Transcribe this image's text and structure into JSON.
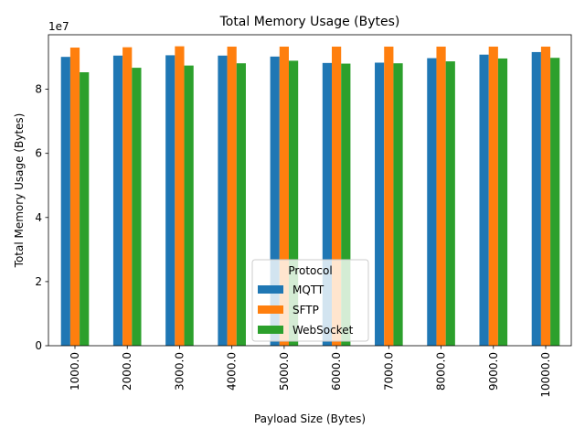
{
  "chart_data": {
    "type": "bar",
    "title": "Total Memory Usage (Bytes)",
    "xlabel": "Payload Size (Bytes)",
    "ylabel": "Total Memory Usage (Bytes)",
    "y_offset_label": "1e7",
    "categories": [
      "1000.0",
      "2000.0",
      "3000.0",
      "4000.0",
      "5000.0",
      "6000.0",
      "7000.0",
      "8000.0",
      "9000.0",
      "10000.0"
    ],
    "ylim": [
      0,
      97000000
    ],
    "yticks": [
      0,
      20000000,
      40000000,
      60000000,
      80000000
    ],
    "ytick_labels": [
      "0",
      "2",
      "4",
      "6",
      "8"
    ],
    "grid": false,
    "legend": {
      "title": "Protocol",
      "placement": "lower-center"
    },
    "series": [
      {
        "name": "MQTT",
        "color": "#1f77b4",
        "values": [
          90100000,
          90500000,
          90600000,
          90500000,
          90200000,
          88200000,
          88300000,
          89700000,
          90800000,
          91600000
        ]
      },
      {
        "name": "SFTP",
        "color": "#ff7f0e",
        "values": [
          93000000,
          93100000,
          93400000,
          93300000,
          93300000,
          93300000,
          93300000,
          93300000,
          93300000,
          93300000
        ]
      },
      {
        "name": "WebSocket",
        "color": "#2ca02c",
        "values": [
          85300000,
          86700000,
          87400000,
          88100000,
          88900000,
          88000000,
          88100000,
          88700000,
          89600000,
          89800000
        ]
      }
    ]
  }
}
